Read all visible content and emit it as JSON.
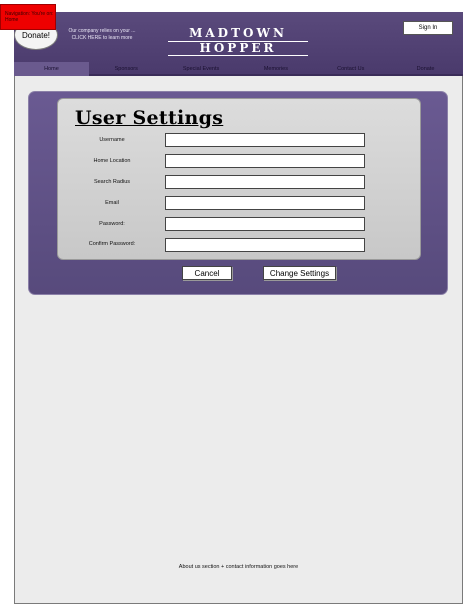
{
  "sticky_note": {
    "text": "Navigation: You're on: Home"
  },
  "donate": {
    "label": "Donate!"
  },
  "promo": {
    "text": "Our company relies on your ... CLICK HERE to learn more"
  },
  "logo": {
    "line1": "MADTOWN",
    "line2": "HOPPER"
  },
  "header": {
    "signin_label": "Sign In"
  },
  "nav": {
    "items": [
      {
        "label": "Home"
      },
      {
        "label": "Sponsors"
      },
      {
        "label": "Special Events"
      },
      {
        "label": "Memories"
      },
      {
        "label": "Contact Us"
      },
      {
        "label": "Donate"
      }
    ],
    "active": "Home"
  },
  "settings": {
    "title": "User Settings",
    "fields": [
      {
        "label": "Username",
        "value": ""
      },
      {
        "label": "Home Location",
        "value": ""
      },
      {
        "label": "Search Radius",
        "value": ""
      },
      {
        "label": "Email",
        "value": ""
      },
      {
        "label": "Password:",
        "value": ""
      },
      {
        "label": "Confirm Password:",
        "value": ""
      }
    ],
    "cancel_label": "Cancel",
    "submit_label": "Change Settings"
  },
  "footer": {
    "text": "About us section + contact information goes here"
  },
  "colors": {
    "header_bg": "#4f3f72",
    "panel_bg": "#5f5088",
    "inner_panel_bg": "#d2d2d2",
    "sticky_note": "#ee0000",
    "page_bg": "#ececec"
  }
}
